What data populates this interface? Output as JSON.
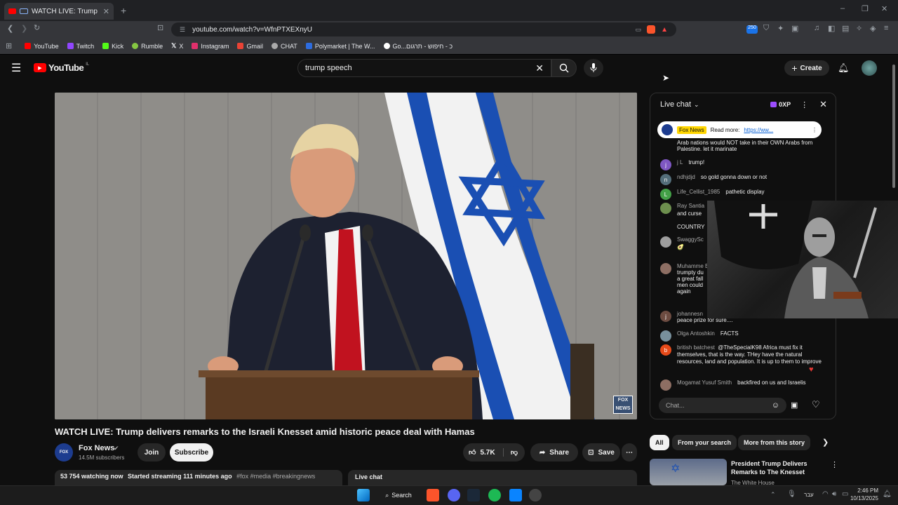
{
  "browser": {
    "tab_title": "WATCH LIVE: Trump delivers",
    "url": "youtube.com/watch?v=WfnPTXEXnyU",
    "bookmarks": [
      "YouTube",
      "Twitch",
      "Kick",
      "Rumble",
      "X",
      "Instagram",
      "Gmail",
      "CHAT",
      "Polymarket | The W...",
      "Go...כ - חיפוש - תרגום"
    ],
    "ext_badge": "250"
  },
  "youtube": {
    "logo": "YouTube",
    "region": "IL",
    "search_value": "trump speech",
    "create_label": "Create"
  },
  "video": {
    "title": "WATCH LIVE: Trump delivers remarks to the Israeli Knesset amid historic peace deal with Hamas",
    "channel": "Fox News",
    "subscribers": "14.5M subscribers",
    "join": "Join",
    "subscribe": "Subscribe",
    "likes": "5.7K",
    "share": "Share",
    "save": "Save",
    "watching": "53 754 watching now",
    "started": "Started streaming 111 minutes ago",
    "tags": "#fox #media #breakingnews",
    "watermark": "FOX NEWS"
  },
  "chat": {
    "header": "Live chat",
    "xp": "0XP",
    "pinned_channel": "Fox News",
    "pinned_text": "Read more:",
    "pinned_link": "https://ww...",
    "input_placeholder": "Chat...",
    "messages": [
      {
        "author": "",
        "text": "Arab nations would NOT take in their OWN Arabs from Palestine. let it marinate",
        "initial": "",
        "color": "#555"
      },
      {
        "author": "j L",
        "text": "trump!",
        "initial": "j",
        "color": "#7e57c2"
      },
      {
        "author": "ndhjdjd",
        "text": "so gold gonna down or not",
        "initial": "n",
        "color": "#546e7a"
      },
      {
        "author": "Life_Cellist_1985",
        "text": "pathetic display",
        "initial": "L",
        "color": "#43a047"
      },
      {
        "author": "Ray Santia",
        "text": "and curse",
        "initial": "",
        "color": "#6d8f4e"
      },
      {
        "author": "",
        "text": "COUNTRY",
        "initial": "",
        "color": ""
      },
      {
        "author": "SwaggySc",
        "text": "",
        "initial": "",
        "color": "#9e9e9e"
      },
      {
        "author": "Muhamme Beauty",
        "text": "trumpty du a great fall men could again",
        "initial": "",
        "color": "#8d6e63"
      },
      {
        "author": "johannesn",
        "text": "peace prize for sure....",
        "initial": "j",
        "color": "#6d4c41"
      },
      {
        "author": "Olga Antoshkin",
        "text": "FACTS",
        "initial": "",
        "color": "#78909c"
      },
      {
        "author": "british batchest",
        "text": "@TheSpecialK98 Africa must fix it themselves, that is the way. THey have the natural resources, land and population. It is up to them to improve",
        "initial": "b",
        "color": "#e64a19"
      },
      {
        "author": "Mogamat Yusuf Smith",
        "text": "backfired on us and Israelis",
        "initial": "",
        "color": "#8d6e63"
      }
    ]
  },
  "recommend": {
    "chips": [
      "All",
      "From your search",
      "More from this story"
    ],
    "first_title": "President Trump Delivers Remarks to The Knesset",
    "first_channel": "The White House"
  },
  "taskbar": {
    "search": "Search",
    "lang": "עבר",
    "time": "2:46 PM",
    "date": "10/13/2025"
  },
  "below_tabs": {
    "live_chat": "Live chat"
  },
  "colors": {
    "accent_red": "#ff0000",
    "bg": "#0f0f0f",
    "israel_blue": "#1a4fb3"
  }
}
